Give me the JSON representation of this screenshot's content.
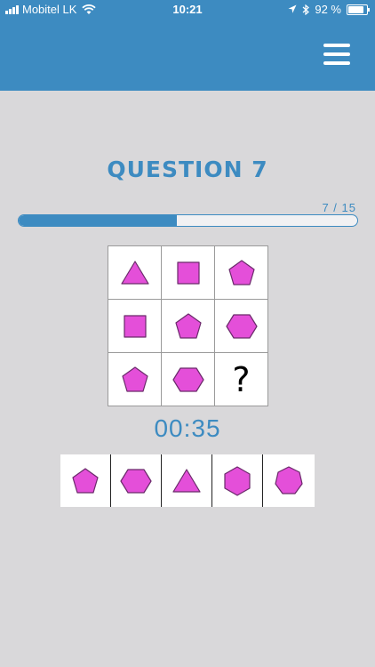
{
  "status_bar": {
    "carrier": "Mobitel LK",
    "time": "10:21",
    "battery": "92 %",
    "battery_level": 0.92,
    "icons": [
      "signal-icon",
      "wifi-icon",
      "location-arrow-icon",
      "bluetooth-icon",
      "battery-icon"
    ]
  },
  "header": {
    "menu_icon": "hamburger-menu-icon",
    "color": "#3d8bc1"
  },
  "question": {
    "title": "QUESTION 7",
    "progress_label": "7 / 15",
    "current": 7,
    "total": 15
  },
  "grid": {
    "cells": [
      "triangle",
      "square",
      "pentagon",
      "square",
      "pentagon",
      "hexagon",
      "pentagon",
      "hexagon",
      "?"
    ],
    "missing_symbol": "?"
  },
  "timer": "00:35",
  "answers": [
    "pentagon",
    "hexagon",
    "triangle",
    "hexagon-vertical",
    "heptagon"
  ],
  "colors": {
    "shape_fill": "#e44fd9",
    "shape_stroke": "#6a2a6a",
    "accent": "#3d8bc1",
    "background": "#d9d8da"
  }
}
